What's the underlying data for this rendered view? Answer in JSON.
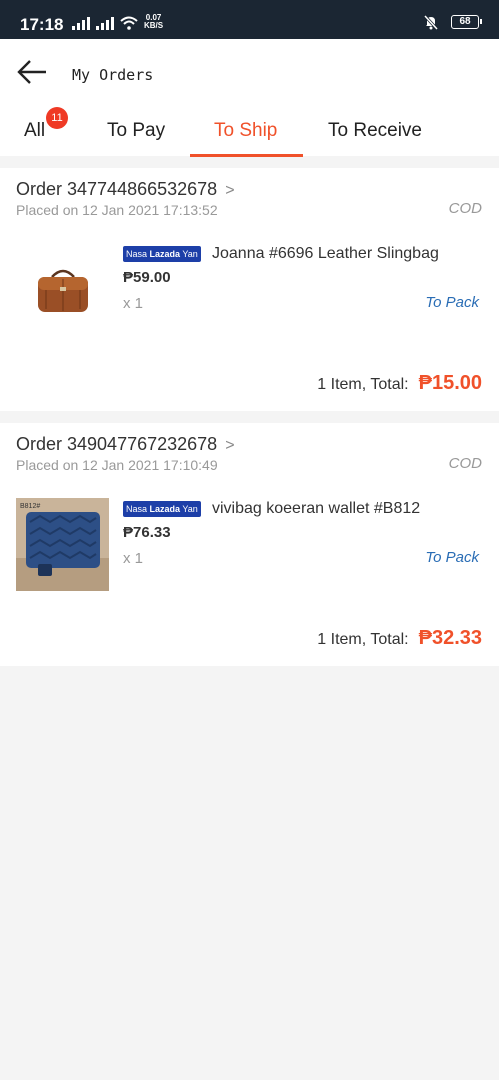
{
  "status_bar": {
    "time": "17:18",
    "net_speed": "0.07",
    "net_speed_unit": "KB/S",
    "battery": "68"
  },
  "header": {
    "title": "My Orders"
  },
  "tabs": [
    {
      "label": "All",
      "badge": "11",
      "active": false
    },
    {
      "label": "To Pay",
      "active": false
    },
    {
      "label": "To Ship",
      "active": true
    },
    {
      "label": "To Receive",
      "active": false
    }
  ],
  "orders": [
    {
      "order_label": "Order 347744866532678",
      "chevron": ">",
      "placed": "Placed on 12 Jan 2021  17:13:52",
      "payment": "COD",
      "store_badge_a": "Nasa",
      "store_badge_b": "Lazada",
      "store_badge_c": "Yan",
      "product_title": "Joanna #6696 Leather Slingbag",
      "price": "₱59.00",
      "qty": "x 1",
      "status": "To Pack",
      "total_label": "1 Item, Total:",
      "total_amount": "₱15.00"
    },
    {
      "order_label": "Order 349047767232678",
      "chevron": ">",
      "placed": "Placed on 12 Jan 2021  17:10:49",
      "payment": "COD",
      "store_badge_a": "Nasa",
      "store_badge_b": "Lazada",
      "store_badge_c": "Yan",
      "product_title": "vivibag koeeran wallet #B812",
      "price": "₱76.33",
      "qty": "x 1",
      "status": "To Pack",
      "total_label": "1 Item, Total:",
      "total_amount": "₱32.33",
      "thumb_label": "B812#"
    }
  ],
  "colors": {
    "accent": "#f0512a",
    "status_bar_bg": "#1b2633",
    "status_link": "#2a6db5",
    "store_badge": "#1d3fa8",
    "tab_badge": "#ef3a25"
  },
  "icons": {
    "back": "arrow-left-icon",
    "signal": "signal-bars-icon",
    "wifi": "wifi-icon",
    "mute": "bell-off-icon",
    "battery": "battery-icon"
  }
}
